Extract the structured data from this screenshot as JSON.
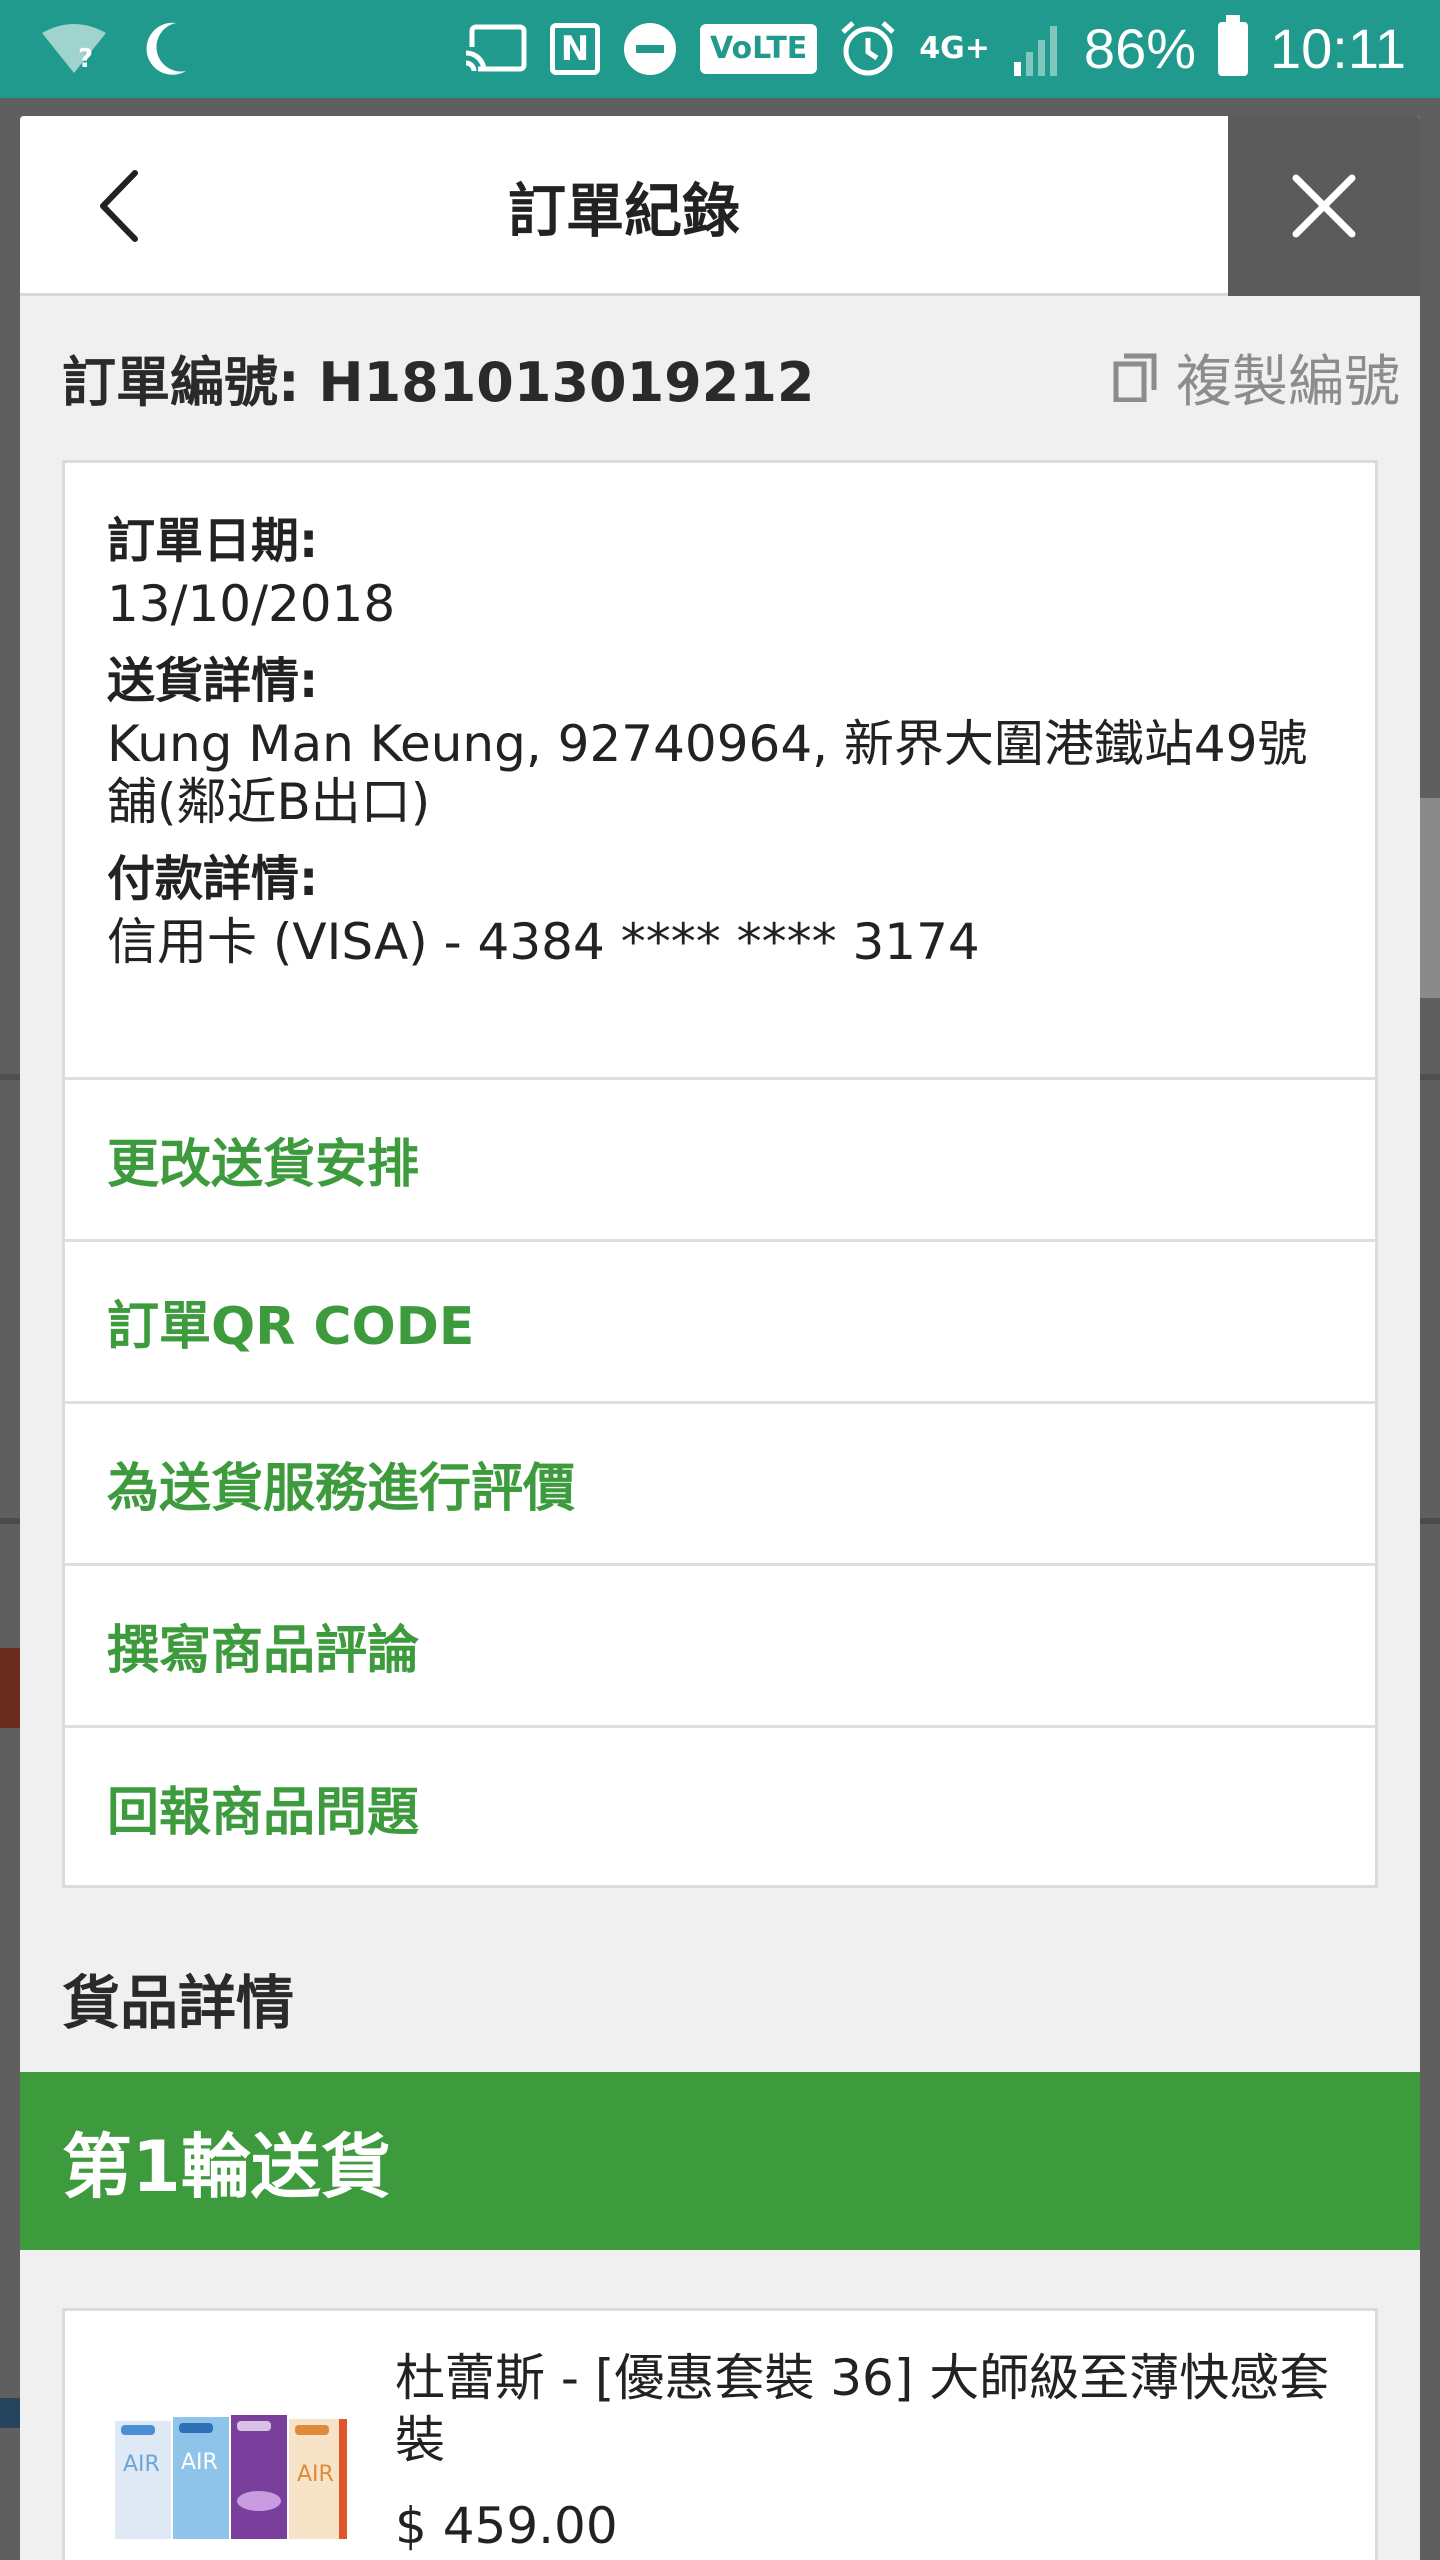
{
  "status_bar": {
    "battery_percent": "86%",
    "time": "10:11",
    "volte": "VoLTE",
    "network": "4G+",
    "nfc": "N",
    "icons": [
      "wifi-question-icon",
      "moon-icon",
      "cast-icon",
      "nfc-icon",
      "dnd-icon",
      "volte-icon",
      "alarm-icon",
      "lte-icon",
      "signal-icon",
      "battery-icon"
    ]
  },
  "header": {
    "title": "訂單紀錄"
  },
  "order": {
    "number_label": "訂單編號: H181013019212",
    "copy_label": "複製編號",
    "date_label": "訂單日期:",
    "date_value": "13/10/2018",
    "delivery_label": "送貨詳情:",
    "delivery_value": "Kung Man Keung, 92740964, 新界大圍港鐵站49號舖(鄰近B出口)",
    "payment_label": "付款詳情:",
    "payment_value": "信用卡 (VISA) - 4384 **** **** 3174"
  },
  "actions": [
    {
      "label": "更改送貨安排"
    },
    {
      "label": "訂單QR CODE"
    },
    {
      "label": "為送貨服務進行評價"
    },
    {
      "label": "撰寫商品評論"
    },
    {
      "label": "回報商品問題"
    }
  ],
  "goods": {
    "section_title": "貨品詳情",
    "delivery_round": "第1輪送貨",
    "products": [
      {
        "name": "杜蕾斯 - [優惠套裝 36] 大師級至薄快感套裝",
        "price": "$ 459.00",
        "box_labels": [
          "AIR",
          "AIR",
          "",
          "AIR"
        ]
      }
    ]
  },
  "colors": {
    "status_bar": "#1f9a8d",
    "accent_green": "#3d9a3d",
    "close_bg": "#5b5b5b"
  }
}
